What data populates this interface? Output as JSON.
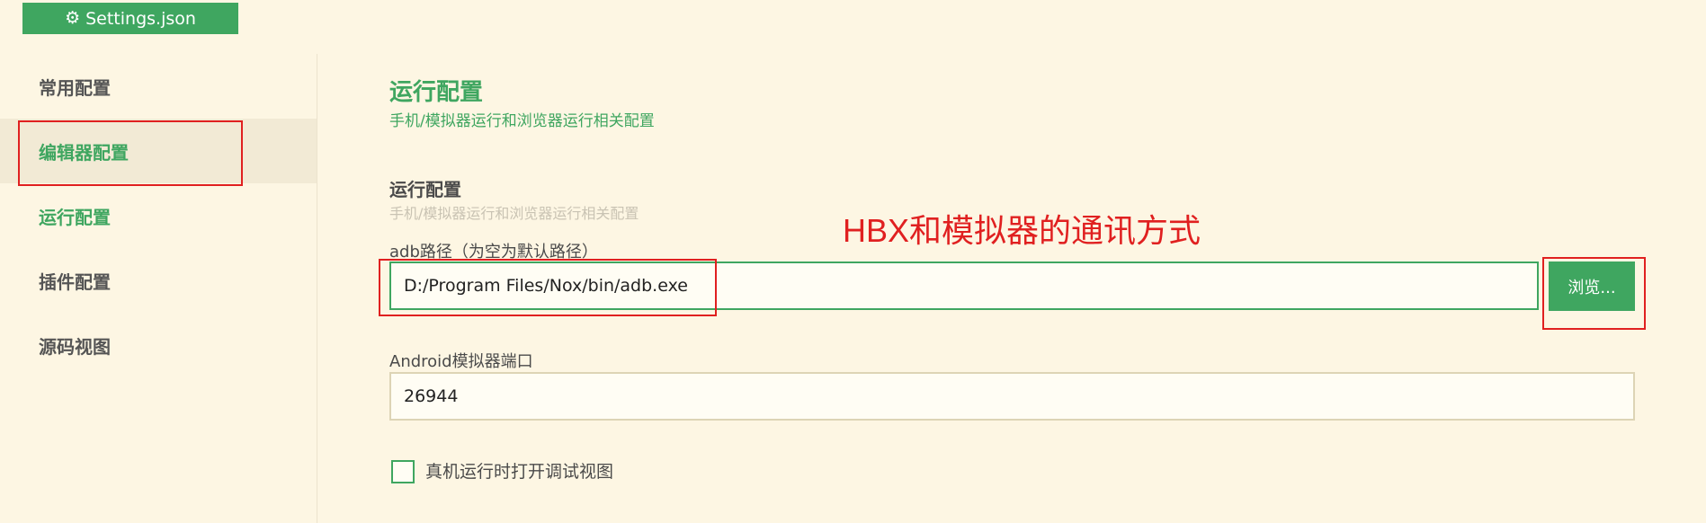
{
  "top_button": {
    "icon": "gear-icon",
    "label": "Settings.json"
  },
  "sidebar": {
    "items": [
      {
        "label": "常用配置"
      },
      {
        "label": "编辑器配置"
      },
      {
        "label": "运行配置"
      },
      {
        "label": "插件配置"
      },
      {
        "label": "源码视图"
      }
    ]
  },
  "main": {
    "title": "运行配置",
    "subtitle": "手机/模拟器运行和浏览器运行相关配置",
    "section": {
      "title": "运行配置",
      "subtitle": "手机/模拟器运行和浏览器运行相关配置"
    },
    "adb": {
      "label": "adb路径（为空为默认路径）",
      "value": "D:/Program Files/Nox/bin/adb.exe",
      "browse_label": "浏览..."
    },
    "port": {
      "label": "Android模拟器端口",
      "value": "26944"
    },
    "debug_view": {
      "label": "真机运行时打开调试视图",
      "checked": false
    }
  },
  "annotation": {
    "text": "HBX和模拟器的通讯方式"
  },
  "colors": {
    "accent": "#3fa660",
    "background": "#fdf6e3",
    "annotation": "#e02020"
  }
}
